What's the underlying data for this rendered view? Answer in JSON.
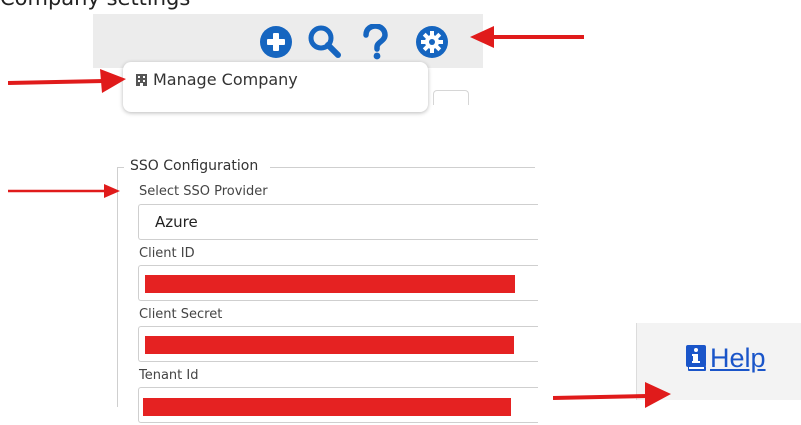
{
  "caption": {
    "text": "Company settings"
  },
  "toolbar": {
    "icons": [
      "plus-circle-icon",
      "search-icon",
      "help-question-icon",
      "settings-gear-icon"
    ],
    "icon_color": "#1565c0"
  },
  "menu": {
    "manage_company_label": "Manage Company"
  },
  "sso": {
    "legend": "SSO Configuration",
    "provider_label": "Select SSO Provider",
    "provider_value": "Azure",
    "client_id_label": "Client ID",
    "client_secret_label": "Client Secret",
    "tenant_id_label": "Tenant Id"
  },
  "help": {
    "label": "Help",
    "link_color": "#1a55c9"
  },
  "annotation": {
    "arrow_color": "#e01b1b",
    "redaction_color": "#e52222"
  }
}
